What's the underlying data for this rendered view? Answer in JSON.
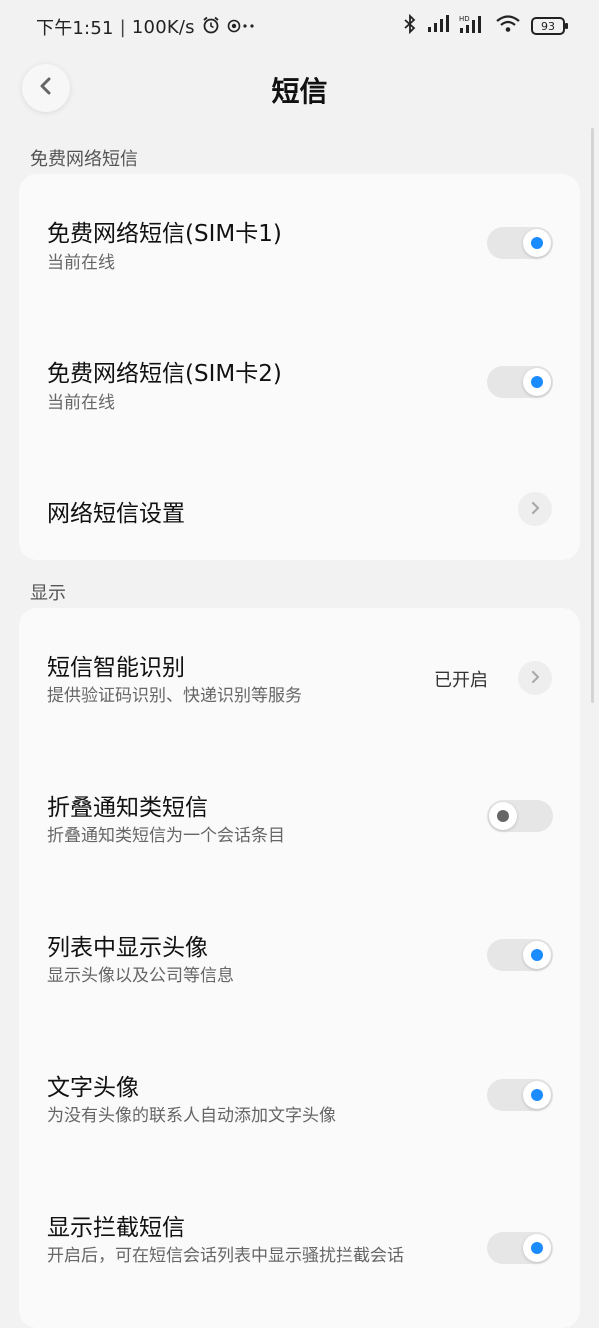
{
  "status_bar": {
    "time": "下午1:51",
    "speed": "100K/s",
    "battery": "93"
  },
  "header": {
    "title": "短信"
  },
  "sections": {
    "free": {
      "label": "免费网络短信",
      "sim1": {
        "title": "免费网络短信(SIM卡1)",
        "subtitle": "当前在线",
        "enabled": true
      },
      "sim2": {
        "title": "免费网络短信(SIM卡2)",
        "subtitle": "当前在线",
        "enabled": true
      },
      "settings": {
        "title": "网络短信设置"
      }
    },
    "display": {
      "label": "显示",
      "smart": {
        "title": "短信智能识别",
        "subtitle": "提供验证码识别、快递识别等服务",
        "value": "已开启"
      },
      "fold": {
        "title": "折叠通知类短信",
        "subtitle": "折叠通知类短信为一个会话条目",
        "enabled": false
      },
      "avatar": {
        "title": "列表中显示头像",
        "subtitle": "显示头像以及公司等信息",
        "enabled": true
      },
      "text_avatar": {
        "title": "文字头像",
        "subtitle": "为没有头像的联系人自动添加文字头像",
        "enabled": true
      },
      "blocked": {
        "title": "显示拦截短信",
        "subtitle": "开启后，可在短信会话列表中显示骚扰拦截会话",
        "enabled": true
      }
    }
  },
  "colors": {
    "accent": "#1a8cff",
    "background": "#f2f2f2",
    "card": "#fafafa"
  }
}
